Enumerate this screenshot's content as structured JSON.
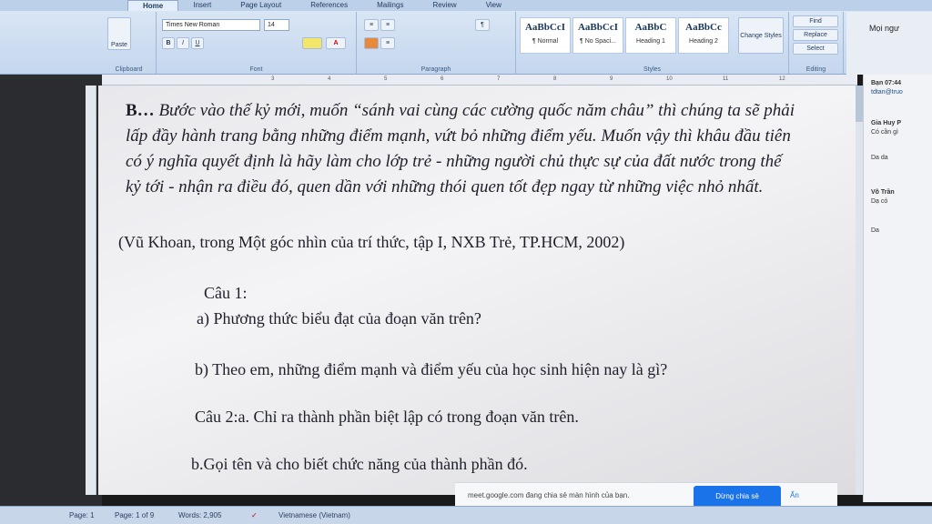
{
  "ribbon": {
    "tabs": [
      "Home",
      "Insert",
      "Page Layout",
      "References",
      "Mailings",
      "Review",
      "View"
    ],
    "clipboard_label": "Clipboard",
    "paste_label": "Paste",
    "font_label": "Font",
    "font_name": "Times New Roman",
    "font_size": "14",
    "paragraph_label": "Paragraph",
    "styles_label": "Styles",
    "styles": [
      {
        "sample": "AaBbCcI",
        "name": "¶ Normal"
      },
      {
        "sample": "AaBbCcI",
        "name": "¶ No Spaci..."
      },
      {
        "sample": "AaBbC",
        "name": "Heading 1"
      },
      {
        "sample": "AaBbCc",
        "name": "Heading 2"
      }
    ],
    "change_styles": "Change Styles",
    "editing_label": "Editing",
    "find": "Find",
    "replace": "Replace",
    "select": "Select",
    "share": "Mọi ngư"
  },
  "document": {
    "lead": "B… ",
    "paragraph": "Bước vào thế kỷ mới, muốn “sánh vai cùng các cường quốc năm châu” thì chúng ta sẽ phải lấp đầy hành trang bằng những điểm mạnh, vứt bỏ những điểm yếu. Muốn vậy thì khâu đầu tiên có ý nghĩa quyết định là hãy làm cho lớp trẻ - những người chủ thực sự của đất nước trong thế kỷ tới - nhận ra điều đó, quen dần với những thói quen tốt đẹp ngay từ những việc nhỏ nhất.",
    "citation": "(Vũ Khoan, trong Một góc nhìn của trí thức, tập I, NXB Trẻ, TP.HCM, 2002)",
    "q1": "Câu 1:",
    "q1a": "a)  Phương thức biểu đạt của đoạn văn trên?",
    "q1b": "b)  Theo em, những điểm mạnh và điểm yếu của học sinh hiện nay là gì?",
    "q2": "Câu 2:a. Chỉ ra thành phần biệt lập có trong đoạn văn trên.",
    "q2b": "b.Gọi tên và cho biết chức năng của thành phần đó."
  },
  "comments": [
    {
      "author": "Bạn 07:44",
      "text": "tdtan@truo"
    },
    {
      "author": "Gia Huy P",
      "text": "Có cần gì"
    },
    {
      "author": "",
      "text": "Da da"
    },
    {
      "author": "Võ Trần",
      "text": "Dạ có"
    },
    {
      "author": "",
      "text": "Da"
    }
  ],
  "sharebar": {
    "message": "meet.google.com đang chia sẻ màn hình của bạn.",
    "stop": "Dừng chia sẻ",
    "hide": "Ẩn"
  },
  "status": {
    "page": "Page: 1",
    "page_of": "Page: 1 of 9",
    "words": "Words: 2,905",
    "language": "Vietnamese (Vietnam)"
  }
}
